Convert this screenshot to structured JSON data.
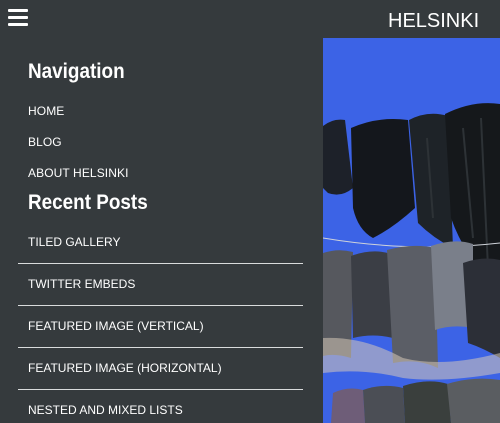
{
  "header": {
    "menu_icon": "hamburger-menu-icon",
    "site_title": "HELSINKI"
  },
  "navigation": {
    "heading": "Navigation",
    "items": [
      {
        "label": "HOME"
      },
      {
        "label": "BLOG"
      },
      {
        "label": "ABOUT HELSINKI"
      }
    ]
  },
  "recent_posts": {
    "heading": "Recent Posts",
    "items": [
      {
        "label": "TILED GALLERY"
      },
      {
        "label": "TWITTER EMBEDS"
      },
      {
        "label": "FEATURED IMAGE (VERTICAL)"
      },
      {
        "label": "FEATURED IMAGE (HORIZONTAL)"
      },
      {
        "label": "NESTED AND MIXED LISTS"
      }
    ]
  },
  "colors": {
    "background": "#353a3d",
    "text": "#ffffff",
    "sky": "#3c63e6",
    "divider": "#d9dbdc"
  }
}
